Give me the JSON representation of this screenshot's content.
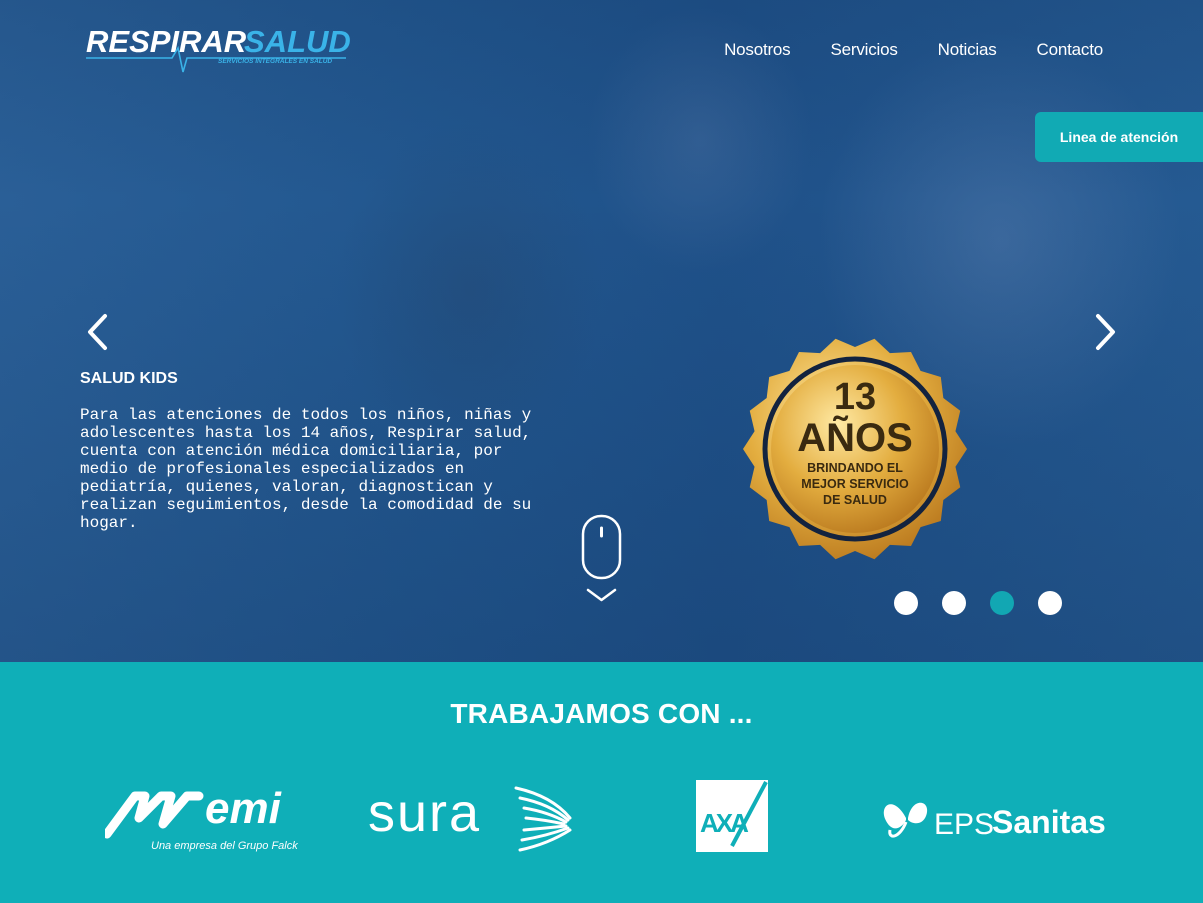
{
  "brand": {
    "name_a": "RESPIRAR",
    "name_b": "SALUD",
    "tagline": "SERVICIOS INTEGRALES EN SALUD"
  },
  "nav": {
    "items": [
      "Nosotros",
      "Servicios",
      "Noticias",
      "Contacto"
    ]
  },
  "cta": {
    "label": "Linea de atención"
  },
  "slide": {
    "title": "SALUD KIDS",
    "text": "Para las atenciones de todos los niños, niñas y adolescentes hasta los 14 años, Respirar salud, cuenta con atención médica domiciliaria, por medio de profesionales especializados en pediatría, quienes, valoran, diagnostican y realizan seguimientos, desde la comodidad de su hogar."
  },
  "badge": {
    "years": "13",
    "unit": "AÑOS",
    "line1": "BRINDANDO EL",
    "line2": "MEJOR SERVICIO",
    "line3": "DE SALUD"
  },
  "carousel": {
    "total": 4,
    "active": 3
  },
  "partners": {
    "title": "TRABAJAMOS CON ...",
    "emi": {
      "name": "emi",
      "subtitle": "Una empresa del Grupo Falck"
    },
    "sura": {
      "name": "sura"
    },
    "axa": {
      "name": "AXA"
    },
    "sanitas": {
      "prefix": "EPS",
      "name": "Sanitas"
    }
  },
  "colors": {
    "accent": "#0fafb8",
    "hero": "#235890",
    "gold": "#e0a93a"
  }
}
